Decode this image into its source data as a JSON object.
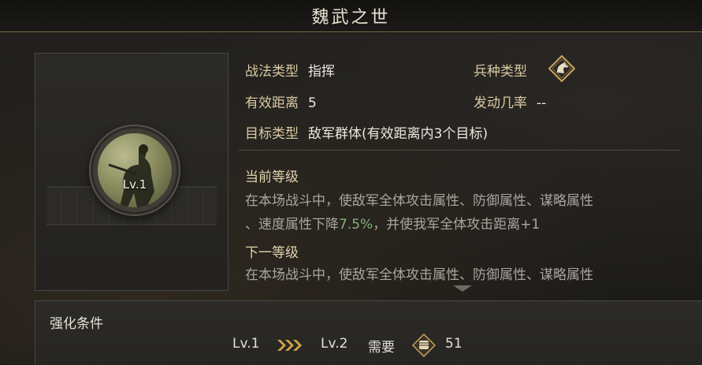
{
  "title": "魏武之世",
  "skill": {
    "level_badge": "Lv.1"
  },
  "info": {
    "tactic_type_label": "战法类型",
    "tactic_type_value": "指挥",
    "troop_type_label": "兵种类型",
    "troop_type_icon": "horse-icon",
    "range_label": "有效距离",
    "range_value": "5",
    "trigger_rate_label": "发动几率",
    "trigger_rate_value": "--",
    "target_type_label": "目标类型",
    "target_type_value": "敌军群体(有效距离内3个目标)"
  },
  "current_level": {
    "heading": "当前等级",
    "line1": "在本场战斗中，使敌军全体攻击属性、防御属性、谋略属性",
    "line2_a": "、速度属性下降",
    "line2_value": "7.5%",
    "line2_b": "，并使我军全体攻击距离+1"
  },
  "next_level": {
    "heading": "下一等级",
    "line1": "在本场战斗中，使敌军全体攻击属性、防御属性、谋略属性"
  },
  "upgrade": {
    "title": "强化条件",
    "from_level": "Lv.1",
    "to_level": "Lv.2",
    "need_label": "需要",
    "cost_icon": "fist-token-icon",
    "cost_value": "51"
  },
  "colors": {
    "highlight": "#7fb37a",
    "gold_border": "#8a7650",
    "label": "#d8c9a3"
  }
}
